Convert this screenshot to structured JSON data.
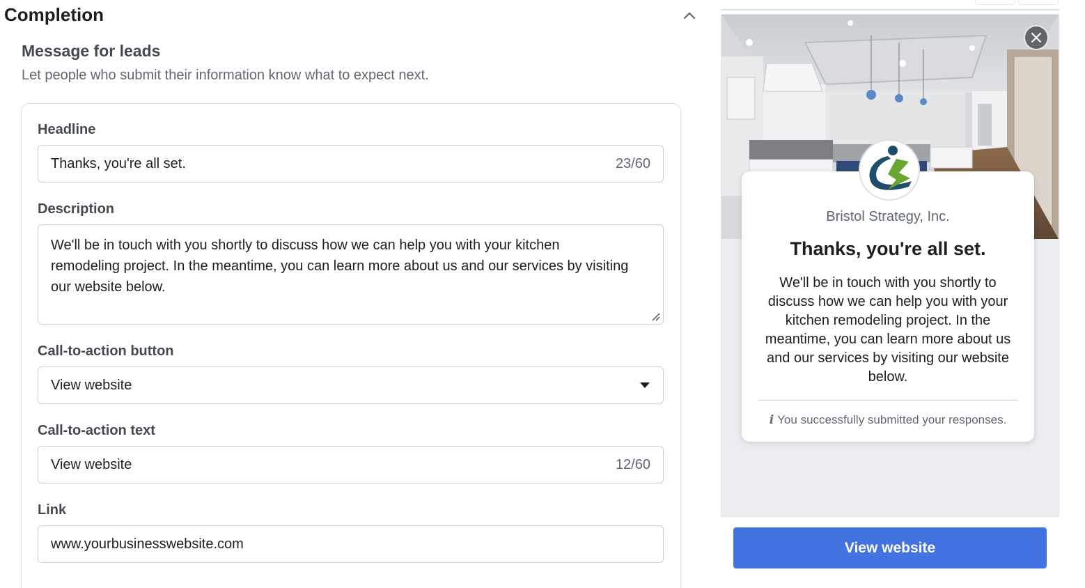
{
  "section": {
    "title": "Completion"
  },
  "message": {
    "title": "Message for leads",
    "description": "Let people who submit their information know what to expect next."
  },
  "form": {
    "headline": {
      "label": "Headline",
      "value": "Thanks, you're all set.",
      "counter": "23/60"
    },
    "description": {
      "label": "Description",
      "value": "We'll be in touch with you shortly to discuss how we can help you with your kitchen remodeling project. In the meantime, you can learn more about us and our services by visiting our website below."
    },
    "cta_button": {
      "label": "Call-to-action button",
      "selected": "View website"
    },
    "cta_text": {
      "label": "Call-to-action text",
      "value": "View website",
      "counter": "12/60"
    },
    "link": {
      "label": "Link",
      "value": "www.yourbusinesswebsite.com"
    }
  },
  "preview": {
    "company": "Bristol Strategy, Inc.",
    "headline": "Thanks, you're all set.",
    "description": "We'll be in touch with you shortly to discuss how we can help you with your kitchen remodeling project. In the meantime, you can learn more about us and our services by visiting our website below.",
    "notice": "You successfully submitted your responses.",
    "notice_icon": "i",
    "button": "View website"
  },
  "colors": {
    "accent": "#4373e0",
    "logo_green": "#6aa531",
    "logo_navy": "#1f4e6b"
  },
  "icons": {
    "collapse": "chevron-up-icon",
    "close": "close-icon",
    "dropdown": "caret-down-icon",
    "info": "info-icon",
    "resize": "resize-handle-icon"
  }
}
